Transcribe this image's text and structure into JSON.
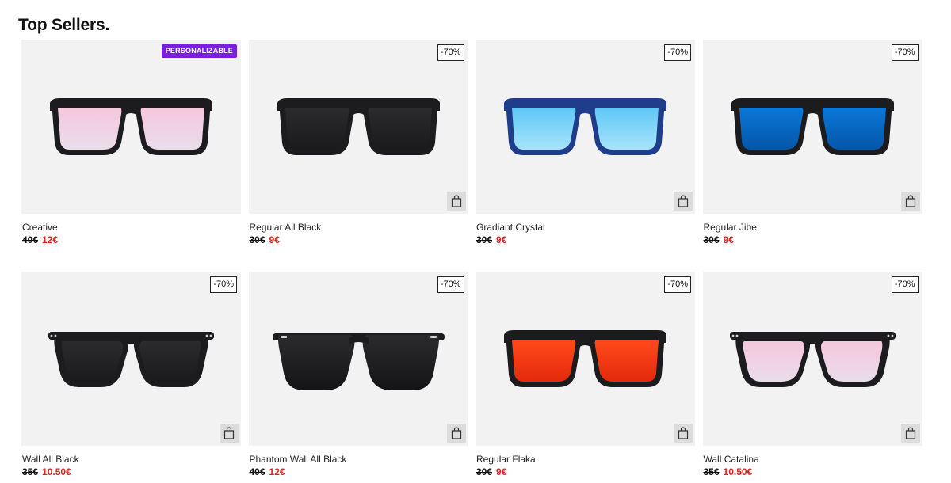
{
  "title": "Top Sellers.",
  "products": [
    {
      "name": "Creative",
      "old_price": "40€",
      "new_price": "12€",
      "badge": "PERSONALIZABLE",
      "badge_type": "custom",
      "has_cart": false,
      "style": "regular",
      "frame_color": "#1c1c1e",
      "lens_top": "#f6c7dd",
      "lens_bottom": "#e9ddea",
      "icon": "sunglasses-icon"
    },
    {
      "name": "Regular All Black",
      "old_price": "30€",
      "new_price": "9€",
      "badge": "-70%",
      "badge_type": "discount",
      "has_cart": true,
      "style": "regular",
      "frame_color": "#1c1c1e",
      "lens_top": "#2b2b2d",
      "lens_bottom": "#1a1a1c",
      "icon": "sunglasses-icon"
    },
    {
      "name": "Gradiant Crystal",
      "old_price": "30€",
      "new_price": "9€",
      "badge": "-70%",
      "badge_type": "discount",
      "has_cart": true,
      "style": "regular",
      "frame_color": "#1f3d8a",
      "lens_top": "#5ec7f5",
      "lens_bottom": "#a8e4fb",
      "icon": "sunglasses-icon"
    },
    {
      "name": "Regular Jibe",
      "old_price": "30€",
      "new_price": "9€",
      "badge": "-70%",
      "badge_type": "discount",
      "has_cart": true,
      "style": "regular",
      "frame_color": "#1c1c1e",
      "lens_top": "#0a78d8",
      "lens_bottom": "#0556a8",
      "icon": "sunglasses-icon"
    },
    {
      "name": "Wall All Black",
      "old_price": "35€",
      "new_price": "10.50€",
      "badge": "-70%",
      "badge_type": "discount",
      "has_cart": true,
      "style": "wall",
      "frame_color": "#1c1c1e",
      "lens_top": "#2b2b2d",
      "lens_bottom": "#1a1a1c",
      "icon": "sunglasses-icon"
    },
    {
      "name": "Phantom Wall All Black",
      "old_price": "40€",
      "new_price": "12€",
      "badge": "-70%",
      "badge_type": "discount",
      "has_cart": true,
      "style": "phantom",
      "frame_color": "#1c1c1e",
      "lens_top": "#2b2b2d",
      "lens_bottom": "#141416",
      "icon": "sunglasses-icon"
    },
    {
      "name": "Regular Flaka",
      "old_price": "30€",
      "new_price": "9€",
      "badge": "-70%",
      "badge_type": "discount",
      "has_cart": true,
      "style": "regular",
      "frame_color": "#1c1c1e",
      "lens_top": "#ff4a1a",
      "lens_bottom": "#e42a0c",
      "icon": "sunglasses-icon"
    },
    {
      "name": "Wall Catalina",
      "old_price": "35€",
      "new_price": "10.50€",
      "badge": "-70%",
      "badge_type": "discount",
      "has_cart": true,
      "style": "wall",
      "frame_color": "#1c1c1e",
      "lens_top": "#f6c7dd",
      "lens_bottom": "#e9ddea",
      "icon": "sunglasses-icon"
    }
  ],
  "colors": {
    "card_bg": "#f2f2f2",
    "sale_price": "#e0201a",
    "badge_purple": "#7a1fe0",
    "cart_button_bg": "#dcdcdc"
  }
}
